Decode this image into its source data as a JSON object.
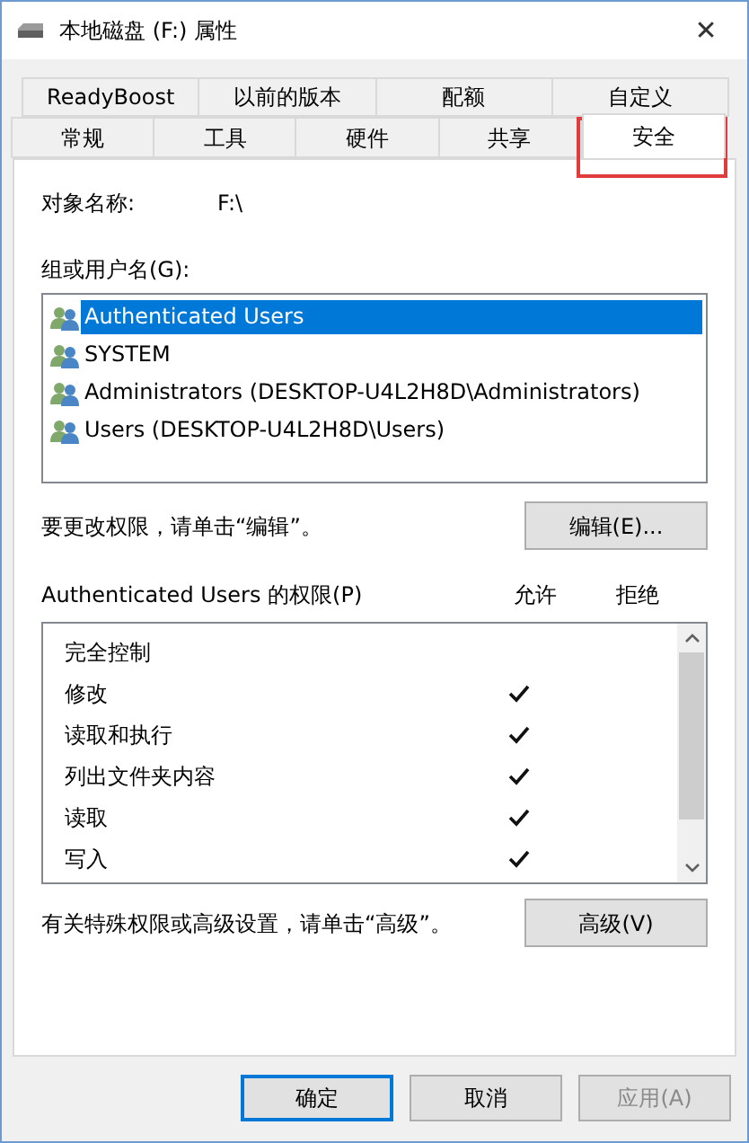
{
  "window": {
    "title": "本地磁盘 (F:) 属性",
    "close": "✕"
  },
  "tabs_row_1": [
    {
      "label": "ReadyBoost",
      "selected": false
    },
    {
      "label": "以前的版本",
      "selected": false
    },
    {
      "label": "配额",
      "selected": false
    },
    {
      "label": "自定义",
      "selected": false
    }
  ],
  "tabs_row_2": [
    {
      "label": "常规",
      "selected": false
    },
    {
      "label": "工具",
      "selected": false
    },
    {
      "label": "硬件",
      "selected": false
    },
    {
      "label": "共享",
      "selected": false
    },
    {
      "label": "安全",
      "selected": true
    }
  ],
  "object_name": {
    "label": "对象名称:",
    "value": "F:\\"
  },
  "groups": {
    "label": "组或用户名(G):",
    "items": [
      {
        "name": "Authenticated Users",
        "selected": true
      },
      {
        "name": "SYSTEM",
        "selected": false
      },
      {
        "name": "Administrators (DESKTOP-U4L2H8D\\Administrators)",
        "selected": false
      },
      {
        "name": "Users (DESKTOP-U4L2H8D\\Users)",
        "selected": false
      }
    ]
  },
  "edit_hint": "要更改权限，请单击“编辑”。",
  "edit_button": "编辑(E)...",
  "permissions": {
    "label": "Authenticated Users 的权限(P)",
    "allow_header": "允许",
    "deny_header": "拒绝",
    "items": [
      {
        "name": "完全控制",
        "allow": false
      },
      {
        "name": "修改",
        "allow": true
      },
      {
        "name": "读取和执行",
        "allow": true
      },
      {
        "name": "列出文件夹内容",
        "allow": true
      },
      {
        "name": "读取",
        "allow": true
      },
      {
        "name": "写入",
        "allow": true
      }
    ]
  },
  "advanced_hint": "有关特殊权限或高级设置，请单击“高级”。",
  "advanced_button": "高级(V)",
  "buttons": [
    {
      "label": "确定",
      "default": true,
      "disabled": false
    },
    {
      "label": "取消",
      "default": false,
      "disabled": false
    },
    {
      "label": "应用(A)",
      "default": false,
      "disabled": true
    }
  ]
}
